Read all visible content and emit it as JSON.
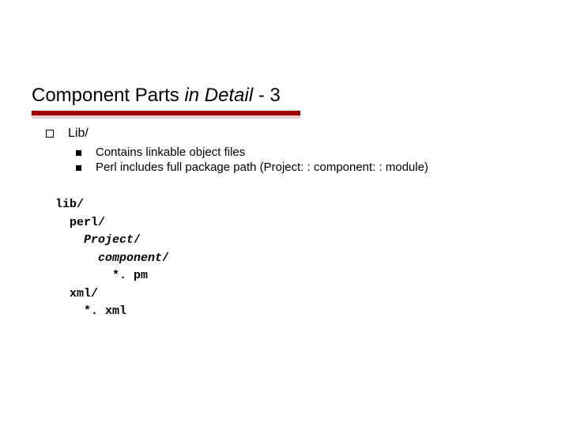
{
  "title": {
    "plain1": "Component Parts ",
    "italic": "in Detail",
    "plain2": " - 3"
  },
  "level1": {
    "text": "Lib/"
  },
  "level2": [
    "Contains linkable object files",
    "Perl includes full package path (Project: : component: : module)"
  ],
  "code": {
    "l1": "lib/",
    "l2": "  perl/",
    "l3_italic": "    Project",
    "l3_plain": "/",
    "l4_italic": "      component",
    "l4_plain": "/",
    "l5": "        *. pm",
    "l6": "  xml/",
    "l7": "    *. xml"
  }
}
